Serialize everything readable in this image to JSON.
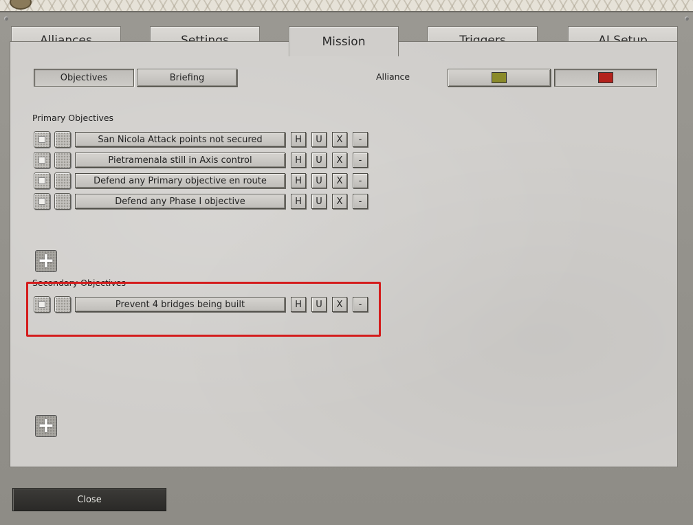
{
  "tabs": [
    {
      "label": "Alliances",
      "active": false
    },
    {
      "label": "Settings",
      "active": false
    },
    {
      "label": "Mission",
      "active": true
    },
    {
      "label": "Triggers",
      "active": false
    },
    {
      "label": "AI Setup",
      "active": false
    }
  ],
  "subtabs": {
    "objectives": "Objectives",
    "briefing": "Briefing"
  },
  "alliance": {
    "label": "Alliance",
    "colors": [
      "#8a8a2a",
      "#b3221c"
    ]
  },
  "primary": {
    "heading": "Primary Objectives",
    "items": [
      "San Nicola Attack points not secured",
      "Pietramenala still in Axis control",
      "Defend any Primary objective en route",
      "Defend any Phase I objective"
    ]
  },
  "secondary": {
    "heading": "Secondary Objectives",
    "items": [
      "Prevent 4 bridges being built"
    ]
  },
  "row_buttons": {
    "h": "H",
    "u": "U",
    "x": "X",
    "minus": "-"
  },
  "add_icon": "+",
  "close_label": "Close"
}
